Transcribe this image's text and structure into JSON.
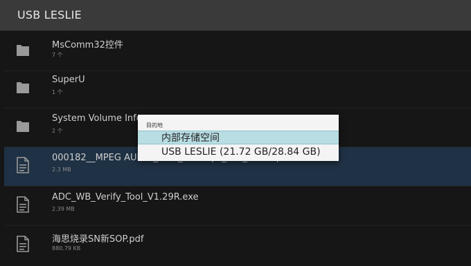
{
  "header": {
    "title": "USB LESLIE"
  },
  "files": [
    {
      "type": "folder",
      "icon": "folder-icon",
      "name": "MsComm32控件",
      "meta": "7 个",
      "selected": false
    },
    {
      "type": "folder",
      "icon": "folder-icon",
      "name": "SuperU",
      "meta": "1 个",
      "selected": false
    },
    {
      "type": "folder",
      "icon": "folder-icon",
      "name": "System Volume Infor",
      "meta": "2 个",
      "selected": false
    },
    {
      "type": "file",
      "icon": "document-icon",
      "name": "000182__MPEG AUDIO_MPG_320Kbps_2ch_48K.mp3",
      "meta": "2.3 MB",
      "selected": true
    },
    {
      "type": "file",
      "icon": "document-icon",
      "name": "ADC_WB_Verify_Tool_V1.29R.exe",
      "meta": "2.39 MB",
      "selected": false
    },
    {
      "type": "file",
      "icon": "document-icon",
      "name": "海思烧录SN新SOP.pdf",
      "meta": "880.79 KB",
      "selected": false
    }
  ],
  "dialog": {
    "title": "目的地",
    "options": [
      {
        "label": "内部存储空间",
        "highlighted": true
      },
      {
        "label": "USB LESLIE (21.72 GB/28.84 GB)",
        "highlighted": false
      }
    ]
  },
  "colors": {
    "background": "#161616",
    "topbar": "#3a3a3a",
    "selected_row": "#1f3144",
    "dialog_highlight": "#b8dde2"
  }
}
